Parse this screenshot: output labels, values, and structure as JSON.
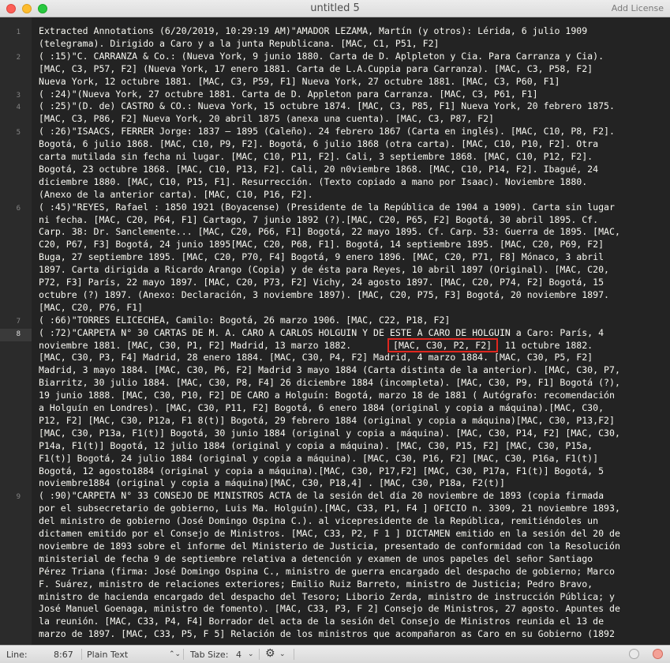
{
  "window": {
    "title": "untitled 5",
    "add_license": "Add License"
  },
  "gutter": {
    "active_line": "8",
    "line_numbers": [
      {
        "label": "1",
        "row": 0
      },
      {
        "label": "2",
        "row": 2
      },
      {
        "label": "3",
        "row": 5
      },
      {
        "label": "4",
        "row": 6
      },
      {
        "label": "5",
        "row": 8
      },
      {
        "label": "6",
        "row": 14
      },
      {
        "label": "7",
        "row": 23
      },
      {
        "label": "8",
        "row": 24
      },
      {
        "label": "9",
        "row": 37
      }
    ]
  },
  "editor": {
    "lines": [
      "Extracted Annotations (6/20/2019, 10:29:19 AM)\"AMADOR LEZAMA, Martín (y otros): Lérida, 6 julio 1909",
      "(telegrama). Dirigido a Caro y a la junta Republicana. [MAC, C1, P51, F2]",
      "( :15)\"C. CARRANZA & Co.: (Nueva York, 9 junio 1880. Carta de D. Aplpleton y Cia. Para Carranza y Cia).",
      "[MAC, C3, P57, F2] (Nueva York, 17 enero 1881. Carta de L.A.Cuppia para Carranza). [MAC, C3, P58, F2]",
      "Nueva York, 12 octubre 1881. [MAC, C3, P59, F1] Nueva York, 27 octubre 1881. [MAC, C3, P60, F1]",
      "( :24)\"(Nueva York, 27 octubre 1881. Carta de D. Appleton para Carranza. [MAC, C3, P61, F1]",
      "( :25)\"(D. de) CASTRO & CO.: Nueva York, 15 octubre 1874. [MAC, C3, P85, F1] Nueva York, 20 febrero 1875.",
      "[MAC, C3, P86, F2] Nueva York, 20 abril 1875 (anexa una cuenta). [MAC, C3, P87, F2]",
      "( :26)\"ISAACS, FERRER Jorge: 1837 – 1895 (Caleño). 24 febrero 1867 (Carta en inglés). [MAC, C10, P8, F2].",
      "Bogotá, 6 julio 1868. [MAC, C10, P9, F2]. Bogotá, 6 julio 1868 (otra carta). [MAC, C10, P10, F2]. Otra",
      "carta mutilada sin fecha ni lugar. [MAC, C10, P11, F2]. Cali, 3 septiembre 1868. [MAC, C10, P12, F2].",
      "Bogotá, 23 octubre 1868. [MAC, C10, P13, F2]. Cali, 20 n0viembre 1868. [MAC, C10, P14, F2]. Ibagué, 24",
      "diciembre 1880. [MAC, C10, P15, F1]. Resurrección. (Texto copiado a mano por Isaac). Noviembre 1880.",
      "(Anexo de la anterior carta). [MAC, C10, P16, F2].",
      "( :45)\"REYES, Rafael : 1850 1921 (Boyacense) (Presidente de la República de 1904 a 1909). Carta sin lugar",
      "ni fecha. [MAC, C20, P64, F1] Cartago, 7 junio 1892 (?).[MAC, C20, P65, F2] Bogotá, 30 abril 1895. Cf.",
      "Carp. 38: Dr. Sanclemente... [MAC, C20, P66, F1] Bogotá, 22 mayo 1895. Cf. Carp. 53: Guerra de 1895. [MAC,",
      "C20, P67, F3] Bogotá, 24 junio 1895[MAC, C20, P68, F1]. Bogotá, 14 septiembre 1895. [MAC, C20, P69, F2]",
      "Buga, 27 septiembre 1895. [MAC, C20, P70, F4] Bogotá, 9 enero 1896. [MAC, C20, P71, F8] Mónaco, 3 abril",
      "1897. Carta dirigida a Ricardo Arango (Copia) y de ésta para Reyes, 10 abril 1897 (Original). [MAC, C20,",
      "P72, F3] París, 22 mayo 1897. [MAC, C20, P73, F2] Vichy, 24 agosto 1897. [MAC, C20, P74, F2] Bogotá, 15",
      "octubre (?) 1897. (Anexo: Declaración, 3 noviembre 1897). [MAC, C20, P75, F3] Bogotá, 20 noviembre 1897.",
      "[MAC, C20, P76, F1]",
      "( :66)\"TORRES ELICECHEA, Camilo: Bogotá, 26 marzo 1906. [MAC, C22, P18, F2]",
      "( :72)\"CARPETA N° 30 CARTAS DE M. A. CARO A CARLOS HOLGUIN Y DE ESTE A CARO DE HOLGUIN a Caro: París, 4",
      "noviembre 1881. [MAC, C30, P1, F2] Madrid, 13 marzo 1882.                    Madrid, 11 octubre 1882.",
      "[MAC, C30, P3, F4] Madrid, 28 enero 1884. [MAC, C30, P4, F2] Madrid, 4 marzo 1884. [MAC, C30, P5, F2]",
      "Madrid, 3 mayo 1884. [MAC, C30, P6, F2] Madrid 3 mayo 1884 (Carta distinta de la anterior). [MAC, C30, P7,",
      "Biarritz, 30 julio 1884. [MAC, C30, P8, F4] 26 diciembre 1884 (incompleta). [MAC, C30, P9, F1] Bogotá (?),",
      "19 junio 1888. [MAC, C30, P10, F2] DE CARO a Holguín: Bogotá, marzo 18 de 1881 ( Autógrafo: recomendación",
      "a Holguín en Londres). [MAC, C30, P11, F2] Bogotá, 6 enero 1884 (original y copia a máquina).[MAC, C30,",
      "P12, F2] [MAC, C30, P12a, F1 8(t)] Bogotá, 29 febrero 1884 (original y copia a máquina)[MAC, C30, P13,F2]",
      "[MAC, C30, P13a, F1(t)] Bogotá, 30 junio 1884 (original y copia a máquina). [MAC, C30, P14, F2] [MAC, C30,",
      "P14a, F1(t)] Bogotá, 12 julio 1884 (original y copia a máquina). [MAC, C30, P15, F2] [MAC, C30, P15a,",
      "F1(t)] Bogotá, 24 julio 1884 (original y copia a máquina). [MAC, C30, P16, F2] [MAC, C30, P16a, F1(t)]",
      "Bogotá, 12 agosto1884 (original y copia a máquina).[MAC, C30, P17,F2] [MAC, C30, P17a, F1(t)] Bogotá, 5",
      "noviembre1884 (original y copia a máquina)[MAC, C30, P18,4] . [MAC, C30, P18a, F2(t)]",
      "( :90)\"CARPETA N° 33 CONSEJO DE MINISTROS ACTA de la sesión del día 20 noviembre de 1893 (copia firmada",
      "por el subsecretario de gobierno, Luis Ma. Holguín).[MAC, C33, P1, F4 ] OFICIO n. 3309, 21 noviembre 1893,",
      "del ministro de gobierno (José Domingo Ospina C.). al vicepresidente de la República, remitiéndoles un",
      "dictamen emitido por el Consejo de Ministros. [MAC, C33, P2, F 1 ] DICTAMEN emitido en la sesión del 20 de",
      "noviembre de 1893 sobre el informe del Ministerio de Justicia, presentado de conformidad con la Resolución",
      "ministerial de fecha 9 de septiembre relativa a detención y examen de unos papeles del señor Santiago",
      "Pérez Triana (firma: José Domingo Ospina C., ministro de guerra encargado del despacho de gobierno; Marco",
      "F. Suárez, ministro de relaciones exteriores; Emilio Ruiz Barreto, ministro de Justicia; Pedro Bravo,",
      "ministro de hacienda encargado del despacho del Tesoro; Liborio Zerda, ministro de instrucción Pública; y",
      "José Manuel Goenaga, ministro de fomento). [MAC, C33, P3, F 2] Consejo de Ministros, 27 agosto. Apuntes de",
      "la reunión. [MAC, C33, P4, F4] Borrador del acta de la sesión del Consejo de Ministros reunida el 13 de",
      "marzo de 1897. [MAC, C33, P5, F 5] Relación de los ministros que acompañaron as Caro en su Gobierno (1892"
    ],
    "selection_text": "[MAC, C30, P2, F2]"
  },
  "statusbar": {
    "line_label": "Line:",
    "position": "8:67",
    "syntax": "Plain Text",
    "tab_size_label": "Tab Size:",
    "tab_size": "4"
  }
}
